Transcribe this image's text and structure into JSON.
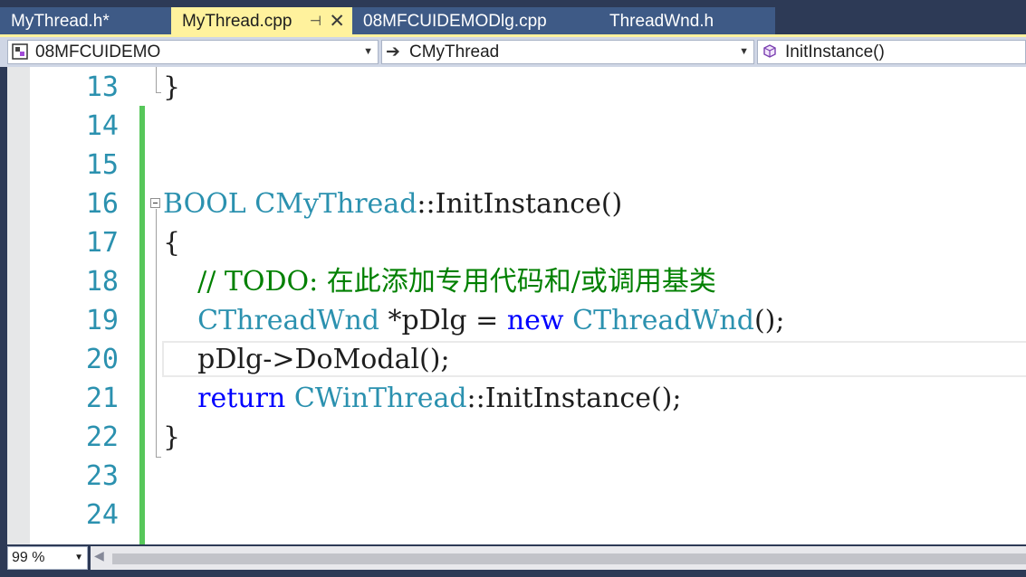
{
  "tabs": [
    {
      "label": "MyThread.h*",
      "active": false
    },
    {
      "label": "MyThread.cpp",
      "active": true
    },
    {
      "label": "08MFCUIDEMODlg.cpp",
      "active": false
    },
    {
      "label": "ThreadWnd.h",
      "active": false
    }
  ],
  "tab_pin_glyph": "⊣",
  "tab_close_glyph": "✕",
  "navigation": {
    "project": "08MFCUIDEMO",
    "project_icon": "project-icon",
    "class": "CMyThread",
    "class_icon": "arrow-right-icon",
    "member": "InitInstance()",
    "member_icon": "method-cube-icon",
    "dropdown_glyph": "▼"
  },
  "editor": {
    "lines": [
      {
        "num": "13",
        "tokens": [
          {
            "t": "}",
            "c": "plain"
          }
        ]
      },
      {
        "num": "14",
        "tokens": []
      },
      {
        "num": "15",
        "tokens": []
      },
      {
        "num": "16",
        "tokens": [
          {
            "t": "BOOL",
            "c": "type"
          },
          {
            "t": " ",
            "c": "plain"
          },
          {
            "t": "CMyThread",
            "c": "type"
          },
          {
            "t": "::InitInstance()",
            "c": "plain"
          }
        ]
      },
      {
        "num": "17",
        "tokens": [
          {
            "t": "{",
            "c": "plain"
          }
        ]
      },
      {
        "num": "18",
        "tokens": [
          {
            "t": "    // TODO: 在此添加专用代码和/或调用基类",
            "c": "comment"
          }
        ]
      },
      {
        "num": "19",
        "tokens": [
          {
            "t": "    ",
            "c": "plain"
          },
          {
            "t": "CThreadWnd",
            "c": "type"
          },
          {
            "t": " *pDlg = ",
            "c": "plain"
          },
          {
            "t": "new",
            "c": "keyword"
          },
          {
            "t": " ",
            "c": "plain"
          },
          {
            "t": "CThreadWnd",
            "c": "type"
          },
          {
            "t": "();",
            "c": "plain"
          }
        ]
      },
      {
        "num": "20",
        "tokens": [
          {
            "t": "    pDlg->DoModal();",
            "c": "plain"
          }
        ]
      },
      {
        "num": "21",
        "tokens": [
          {
            "t": "    ",
            "c": "plain"
          },
          {
            "t": "return",
            "c": "keyword"
          },
          {
            "t": " ",
            "c": "plain"
          },
          {
            "t": "CWinThread",
            "c": "type"
          },
          {
            "t": "::InitInstance();",
            "c": "plain"
          }
        ]
      },
      {
        "num": "22",
        "tokens": [
          {
            "t": "}",
            "c": "plain"
          }
        ]
      },
      {
        "num": "23",
        "tokens": []
      },
      {
        "num": "24",
        "tokens": []
      }
    ],
    "current_line": "20"
  },
  "zoom": "99 %",
  "colors": {
    "tab_active_bg": "#fff29d",
    "keyword": "#0000ff",
    "type": "#2b91af",
    "comment": "#008000",
    "line_number": "#2b91af",
    "change_bar": "#57c75a"
  }
}
